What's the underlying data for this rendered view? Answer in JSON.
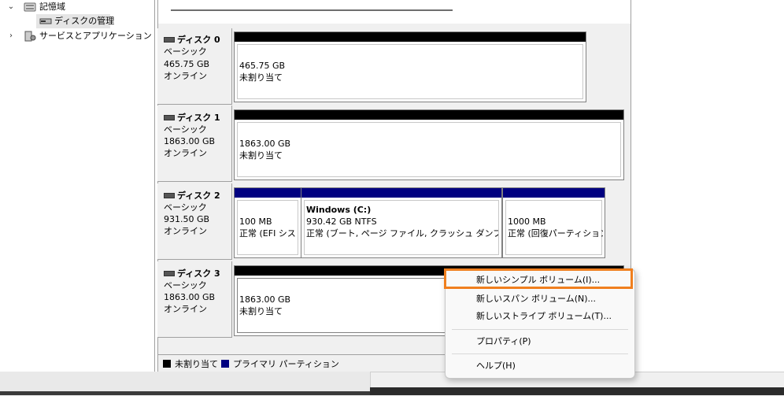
{
  "tree": {
    "items": [
      {
        "label": "記憶域",
        "expanded": true,
        "icon": "storage-icon"
      },
      {
        "label": "ディスクの管理",
        "selected": true,
        "icon": "disk-management-icon"
      },
      {
        "label": "サービスとアプリケーション",
        "expanded": false,
        "icon": "services-icon"
      }
    ]
  },
  "disks": [
    {
      "name": "ディスク 0",
      "type": "ベーシック",
      "size": "465.75 GB",
      "status": "オンライン",
      "partitions": [
        {
          "size": "465.75 GB",
          "desc": "未割り当て",
          "kind": "unallocated"
        }
      ]
    },
    {
      "name": "ディスク 1",
      "type": "ベーシック",
      "size": "1863.00 GB",
      "status": "オンライン",
      "partitions": [
        {
          "size": "1863.00 GB",
          "desc": "未割り当て",
          "kind": "unallocated"
        }
      ]
    },
    {
      "name": "ディスク 2",
      "type": "ベーシック",
      "size": "931.50 GB",
      "status": "オンライン",
      "partitions": [
        {
          "size": "100 MB",
          "desc": "正常 (EFI シス",
          "kind": "primary"
        },
        {
          "title": "Windows  (C:)",
          "size": "930.42 GB NTFS",
          "desc": "正常 (ブート, ページ ファイル, クラッシュ ダンプ, ベーシ",
          "kind": "primary"
        },
        {
          "size": "1000 MB",
          "desc": "正常 (回復パーティション",
          "kind": "primary"
        }
      ]
    },
    {
      "name": "ディスク 3",
      "type": "ベーシック",
      "size": "1863.00 GB",
      "status": "オンライン",
      "partitions": [
        {
          "size": "1863.00 GB",
          "desc": "未割り当て",
          "kind": "unallocated-selected"
        }
      ]
    }
  ],
  "legend": [
    {
      "label": "未割り当て",
      "color": "#000000"
    },
    {
      "label": "プライマリ パーティション",
      "color": "#000080"
    }
  ],
  "context_menu": {
    "items": [
      {
        "label": "新しいシンプル ボリューム(I)...",
        "highlighted": true
      },
      {
        "label": "新しいスパン ボリューム(N)..."
      },
      {
        "label": "新しいストライプ ボリューム(T)..."
      },
      {
        "label": "プロパティ(P)"
      },
      {
        "label": "ヘルプ(H)"
      }
    ]
  },
  "colors": {
    "unallocated": "#000000",
    "primary": "#000080",
    "highlight": "#f07f1e"
  }
}
